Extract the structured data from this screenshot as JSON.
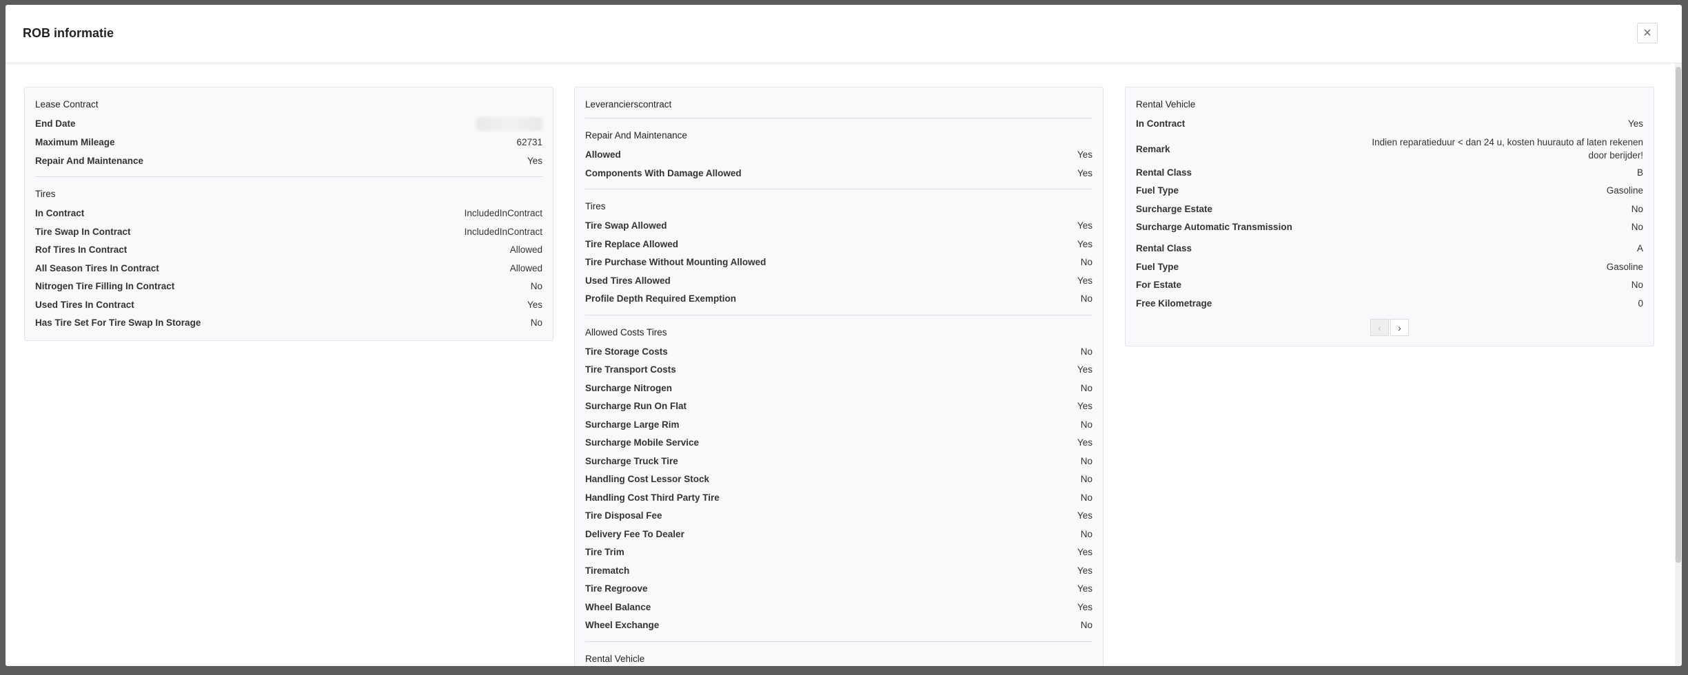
{
  "modal": {
    "title": "ROB informatie",
    "close_icon": "close-icon"
  },
  "lease": {
    "title": "Lease Contract",
    "rows": [
      {
        "label": "End Date",
        "value": ""
      },
      {
        "label": "Maximum Mileage",
        "value": "62731"
      },
      {
        "label": "Repair And Maintenance",
        "value": "Yes"
      }
    ],
    "tires_title": "Tires",
    "tires": [
      {
        "label": "In Contract",
        "value": "IncludedInContract"
      },
      {
        "label": "Tire Swap In Contract",
        "value": "IncludedInContract"
      },
      {
        "label": "Rof Tires In Contract",
        "value": "Allowed"
      },
      {
        "label": "All Season Tires In Contract",
        "value": "Allowed"
      },
      {
        "label": "Nitrogen Tire Filling In Contract",
        "value": "No"
      },
      {
        "label": "Used Tires In Contract",
        "value": "Yes"
      },
      {
        "label": "Has Tire Set For Tire Swap In Storage",
        "value": "No"
      }
    ]
  },
  "supplier": {
    "title": "Leverancierscontract",
    "repair_title": "Repair And Maintenance",
    "repair": [
      {
        "label": "Allowed",
        "value": "Yes"
      },
      {
        "label": "Components With Damage Allowed",
        "value": "Yes"
      }
    ],
    "tires_title": "Tires",
    "tires": [
      {
        "label": "Tire Swap Allowed",
        "value": "Yes"
      },
      {
        "label": "Tire Replace Allowed",
        "value": "Yes"
      },
      {
        "label": "Tire Purchase Without Mounting Allowed",
        "value": "No"
      },
      {
        "label": "Used Tires Allowed",
        "value": "Yes"
      },
      {
        "label": "Profile Depth Required Exemption",
        "value": "No"
      }
    ],
    "costs_title": "Allowed Costs Tires",
    "costs": [
      {
        "label": "Tire Storage Costs",
        "value": "No"
      },
      {
        "label": "Tire Transport Costs",
        "value": "Yes"
      },
      {
        "label": "Surcharge Nitrogen",
        "value": "No"
      },
      {
        "label": "Surcharge Run On Flat",
        "value": "Yes"
      },
      {
        "label": "Surcharge Large Rim",
        "value": "No"
      },
      {
        "label": "Surcharge Mobile Service",
        "value": "Yes"
      },
      {
        "label": "Surcharge Truck Tire",
        "value": "No"
      },
      {
        "label": "Handling Cost Lessor Stock",
        "value": "No"
      },
      {
        "label": "Handling Cost Third Party Tire",
        "value": "No"
      },
      {
        "label": "Tire Disposal Fee",
        "value": "Yes"
      },
      {
        "label": "Delivery Fee To Dealer",
        "value": "No"
      },
      {
        "label": "Tire Trim",
        "value": "Yes"
      },
      {
        "label": "Tirematch",
        "value": "Yes"
      },
      {
        "label": "Tire Regroove",
        "value": "Yes"
      },
      {
        "label": "Wheel Balance",
        "value": "Yes"
      },
      {
        "label": "Wheel Exchange",
        "value": "No"
      }
    ],
    "rental_title": "Rental Vehicle"
  },
  "rental": {
    "title": "Rental Vehicle",
    "rows": [
      {
        "label": "In Contract",
        "value": "Yes"
      },
      {
        "label": "Remark",
        "value": "Indien reparatieduur < dan 24 u, kosten huurauto af laten rekenen door berijder!"
      },
      {
        "label": "Rental Class",
        "value": "B"
      },
      {
        "label": "Fuel Type",
        "value": "Gasoline"
      },
      {
        "label": "Surcharge Estate",
        "value": "No"
      },
      {
        "label": "Surcharge Automatic Transmission",
        "value": "No"
      },
      {
        "label": "Rental Class",
        "value": "A"
      },
      {
        "label": "Fuel Type",
        "value": "Gasoline"
      },
      {
        "label": "For Estate",
        "value": "No"
      },
      {
        "label": "Free Kilometrage",
        "value": "0"
      }
    ],
    "pager": {
      "prev_icon": "chevron-left-icon",
      "next_icon": "chevron-right-icon"
    }
  }
}
